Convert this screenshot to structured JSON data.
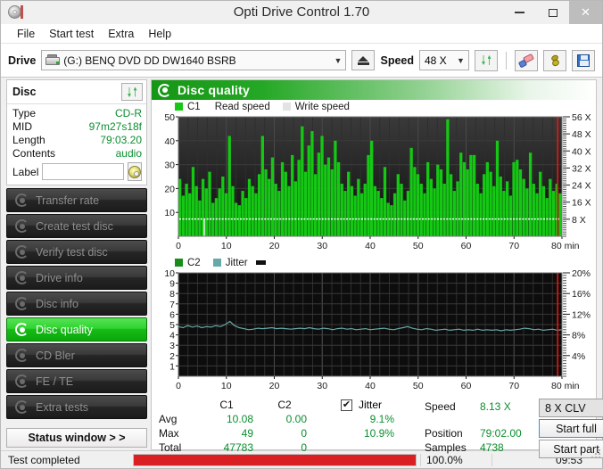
{
  "window": {
    "title": "Opti Drive Control 1.70",
    "app_icon": "disc-icon",
    "minimize": "–",
    "maximize": "□",
    "close": "✕"
  },
  "menu": {
    "items": [
      "File",
      "Start test",
      "Extra",
      "Help"
    ]
  },
  "toolbar": {
    "drive_label": "Drive",
    "drive_value": "(G:)   BENQ DVD DD DW1640 BSRB",
    "drive_icon": "optical-drive-icon",
    "eject_icon": "eject-icon",
    "speed_label": "Speed",
    "speed_value": "48 X",
    "refresh_icon": "refresh-icon",
    "erase_icon": "erase-disc-icon",
    "bug_icon": "bug-icon",
    "save_icon": "save-icon"
  },
  "sidebar": {
    "disc_panel": {
      "title": "Disc",
      "refresh_icon": "refresh-icon",
      "rows": [
        {
          "key": "Type",
          "value": "CD-R"
        },
        {
          "key": "MID",
          "value": "97m27s18f"
        },
        {
          "key": "Length",
          "value": "79:03.20"
        },
        {
          "key": "Contents",
          "value": "audio"
        }
      ],
      "label_key": "Label",
      "label_value": "",
      "label_placeholder": "",
      "disc_button_icon": "disc-icon"
    },
    "nav_items": [
      {
        "label": "Transfer rate",
        "active": false
      },
      {
        "label": "Create test disc",
        "active": false
      },
      {
        "label": "Verify test disc",
        "active": false
      },
      {
        "label": "Drive info",
        "active": false
      },
      {
        "label": "Disc info",
        "active": false
      },
      {
        "label": "Disc quality",
        "active": true
      },
      {
        "label": "CD Bler",
        "active": false
      },
      {
        "label": "FE / TE",
        "active": false
      },
      {
        "label": "Extra tests",
        "active": false
      }
    ],
    "status_window_button": "Status window > >"
  },
  "content": {
    "header_title": "Disc quality",
    "header_icon": "disc-quality-icon"
  },
  "statistics": {
    "col_c1": "C1",
    "col_c2": "C2",
    "jitter_label": "Jitter",
    "jitter_checked": true,
    "jitter_check_glyph": "✔",
    "rows": [
      {
        "key": "Avg",
        "c1": "10.08",
        "c2": "0.00",
        "jitter": "9.1%"
      },
      {
        "key": "Max",
        "c1": "49",
        "c2": "0",
        "jitter": "10.9%"
      },
      {
        "key": "Total",
        "c1": "47783",
        "c2": "0",
        "jitter": ""
      }
    ],
    "speed_key": "Speed",
    "speed_value": "8.13 X",
    "position_key": "Position",
    "position_value": "79:02.00",
    "samples_key": "Samples",
    "samples_value": "4738",
    "clv_value": "8 X CLV",
    "start_full": "Start full",
    "start_part": "Start part"
  },
  "statusbar": {
    "message": "Test completed",
    "percent_text": "100.0%",
    "percent_value": 100,
    "elapsed": "09:53",
    "progress_color": "#d91f21"
  },
  "colors": {
    "c1_green": "#14c814",
    "jitter_teal": "#67a9a9",
    "accent_green": "#0aa80a",
    "value_green": "#0a8f2e",
    "marker_red": "#e81a1a",
    "plot_bg_dark": "#111111"
  },
  "chart_data": [
    {
      "type": "bar",
      "id": "c1-chart",
      "title": "",
      "legend": [
        {
          "label": "C1",
          "color": "#14c814"
        },
        {
          "label": "Read speed",
          "color": "#14c814"
        },
        {
          "label": "Write speed",
          "color": "#dddddd"
        }
      ],
      "legend_position": "top-left",
      "grid": true,
      "xlabel": "min",
      "xlim": [
        0,
        80
      ],
      "xticks": [
        0,
        10,
        20,
        30,
        40,
        50,
        60,
        70,
        80
      ],
      "xticklabels": [
        "0",
        "10",
        "20",
        "30",
        "40",
        "50",
        "60",
        "70",
        "80 min"
      ],
      "ylabel": "",
      "ylim": [
        0,
        50
      ],
      "yticks": [
        10,
        20,
        30,
        40,
        50
      ],
      "yticklabels": [
        "10",
        "20",
        "30",
        "40",
        "50"
      ],
      "y2label": "X",
      "y2lim": [
        0,
        56
      ],
      "y2ticks": [
        8,
        16,
        24,
        32,
        40,
        48,
        56
      ],
      "y2ticklabels": [
        "8 X",
        "16 X",
        "24 X",
        "32 X",
        "40 X",
        "48 X",
        "56 X"
      ],
      "series": [
        {
          "name": "C1",
          "color": "#14c814",
          "values": [
            24,
            17,
            22,
            18,
            29,
            21,
            15,
            24,
            20,
            27,
            14,
            16,
            20,
            25,
            18,
            42,
            21,
            14,
            13,
            19,
            16,
            24,
            21,
            18,
            26,
            42,
            28,
            24,
            33,
            22,
            19,
            31,
            27,
            21,
            34,
            23,
            32,
            46,
            27,
            38,
            44,
            26,
            35,
            42,
            30,
            33,
            28,
            40,
            31,
            22,
            19,
            27,
            21,
            17,
            24,
            18,
            22,
            34,
            40,
            21,
            19,
            16,
            29,
            14,
            13,
            18,
            26,
            22,
            15,
            19,
            37,
            29,
            26,
            22,
            18,
            31,
            24,
            20,
            30,
            28,
            22,
            49,
            26,
            19,
            23,
            35,
            31,
            28,
            34,
            34,
            22,
            18,
            26,
            31,
            27,
            21,
            40,
            25,
            19,
            23,
            17,
            31,
            32,
            28,
            24,
            20,
            35,
            22,
            18,
            27,
            21,
            16,
            24,
            19,
            22,
            18
          ]
        },
        {
          "name": "Read speed",
          "color": "#ffffff",
          "style": "dotted-line",
          "approx_value_x": 8.1,
          "note": "flat dotted white line near 8X across the whole disc"
        }
      ]
    },
    {
      "type": "line",
      "id": "c2-jitter-chart",
      "title": "",
      "legend": [
        {
          "label": "C2",
          "color": "#1a8c1a"
        },
        {
          "label": "Jitter",
          "color": "#67a9a9"
        }
      ],
      "legend_position": "top-left",
      "grid": true,
      "xlabel": "min",
      "xlim": [
        0,
        80
      ],
      "xticks": [
        0,
        10,
        20,
        30,
        40,
        50,
        60,
        70,
        80
      ],
      "xticklabels": [
        "0",
        "10",
        "20",
        "30",
        "40",
        "50",
        "60",
        "70",
        "80 min"
      ],
      "ylabel": "",
      "ylim": [
        0,
        10
      ],
      "yticks": [
        1,
        2,
        3,
        4,
        5,
        6,
        7,
        8,
        9,
        10
      ],
      "yticklabels": [
        "1",
        "2",
        "3",
        "4",
        "5",
        "6",
        "7",
        "8",
        "9",
        "10"
      ],
      "y2label": "%",
      "y2lim": [
        0,
        20
      ],
      "y2ticks": [
        4,
        8,
        12,
        16,
        20
      ],
      "y2ticklabels": [
        "4%",
        "8%",
        "12%",
        "16%",
        "20%"
      ],
      "series": [
        {
          "name": "C2",
          "color": "#1a8c1a",
          "values": [
            0,
            0,
            0,
            0,
            0,
            0,
            0,
            0,
            0,
            0,
            0,
            0,
            0,
            0,
            0,
            0,
            0,
            0,
            0,
            0,
            0,
            0,
            0,
            0,
            0,
            0,
            0,
            0,
            0,
            0,
            0,
            0,
            0,
            0,
            0,
            0,
            0,
            0,
            0,
            0
          ]
        },
        {
          "name": "Jitter",
          "color": "#67a9a9",
          "unit": "%",
          "values": [
            9.6,
            9.4,
            9.8,
            9.5,
            9.7,
            9.4,
            9.6,
            9.5,
            9.8,
            9.6,
            10.0,
            10.6,
            9.8,
            9.4,
            9.2,
            9.0,
            9.1,
            9.3,
            9.2,
            9.3,
            9.4,
            9.2,
            9.3,
            9.2,
            9.1,
            9.2,
            9.3,
            9.2,
            9.4,
            9.2,
            9.1,
            9.3,
            9.2,
            9.0,
            9.2,
            9.3,
            9.1,
            9.2,
            9.0,
            9.1,
            9.2,
            9.0,
            9.1,
            9.2,
            9.3,
            9.1,
            9.0,
            9.2,
            9.4,
            9.6,
            9.3,
            9.1,
            9.0,
            9.2,
            9.1,
            8.9,
            9.0,
            9.1,
            8.9,
            9.0,
            9.1,
            8.9,
            9.0,
            8.9,
            9.1,
            8.9,
            9.0,
            8.9,
            9.0,
            8.8,
            9.0,
            8.9,
            9.0,
            9.1,
            9.3,
            9.2,
            9.0,
            9.1,
            8.9,
            9.0,
            9.1,
            8.9,
            9.0
          ]
        }
      ]
    }
  ]
}
